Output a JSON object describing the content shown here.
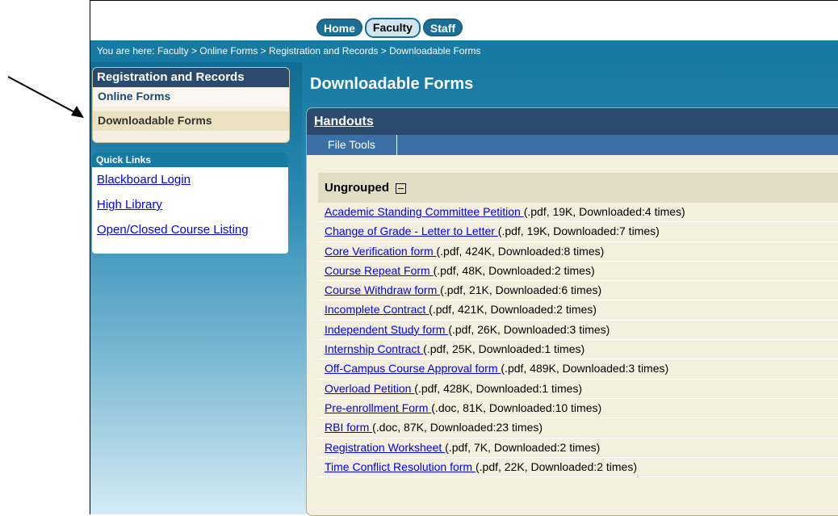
{
  "nav": {
    "tabs": [
      {
        "label": "Home"
      },
      {
        "label": "Faculty"
      },
      {
        "label": "Staff"
      }
    ]
  },
  "breadcrumb": {
    "text": "You are here:  Faculty > Online Forms > Registration and Records > Downloadable Forms"
  },
  "sidebar": {
    "title": "Registration and Records",
    "items": [
      {
        "label": "Online Forms"
      },
      {
        "label": "Downloadable Forms"
      }
    ],
    "quick_links_title": "Quick Links",
    "quick_links": [
      {
        "label": "Blackboard Login"
      },
      {
        "label": "High Library"
      },
      {
        "label": "Open/Closed Course Listing"
      }
    ]
  },
  "main": {
    "page_title": "Downloadable Forms",
    "panel_title": "Handouts",
    "toolbar_button": "File Tools",
    "group_label": "Ungrouped",
    "files": [
      {
        "name": "Academic Standing Committee Petition ",
        "info": "(.pdf, 19K, Downloaded:4 times)"
      },
      {
        "name": "Change of Grade - Letter to Letter ",
        "info": "(.pdf, 19K, Downloaded:7 times)"
      },
      {
        "name": "Core Verification form ",
        "info": "(.pdf, 424K, Downloaded:8 times)"
      },
      {
        "name": "Course Repeat Form ",
        "info": "(.pdf, 48K, Downloaded:2 times)"
      },
      {
        "name": "Course Withdraw form ",
        "info": "(.pdf, 21K, Downloaded:6 times)"
      },
      {
        "name": "Incomplete Contract ",
        "info": "(.pdf, 421K, Downloaded:2 times)"
      },
      {
        "name": "Independent Study form ",
        "info": "(.pdf, 26K, Downloaded:3 times)"
      },
      {
        "name": "Internship Contract ",
        "info": "(.pdf, 25K, Downloaded:1 times)"
      },
      {
        "name": "Off-Campus Course Approval form ",
        "info": "(.pdf, 489K, Downloaded:3 times)"
      },
      {
        "name": "Overload Petition ",
        "info": "(.pdf, 428K, Downloaded:1 times)"
      },
      {
        "name": "Pre-enrollment Form ",
        "info": "(.doc, 81K, Downloaded:10 times)"
      },
      {
        "name": "RBI form ",
        "info": "(.doc, 87K, Downloaded:23 times)"
      },
      {
        "name": "Registration Worksheet ",
        "info": "(.pdf, 7K, Downloaded:2 times)"
      },
      {
        "name": "Time Conflict Resolution form ",
        "info": "(.pdf, 22K, Downloaded:2 times)"
      }
    ]
  },
  "colors": {
    "nav_blue": "#177aa3",
    "dark_header": "#2a4a6e",
    "panel_bg": "#f4efdf",
    "link": "#0000ee"
  }
}
